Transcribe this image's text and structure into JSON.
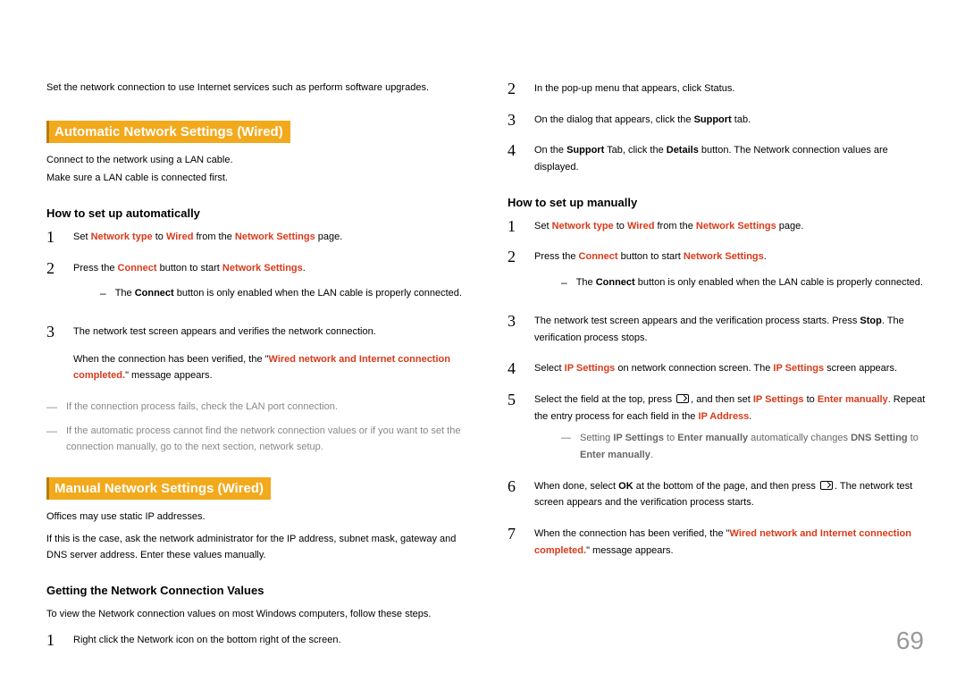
{
  "pageNumber": "69",
  "left": {
    "intro": "Set the network connection to use Internet services such as perform software upgrades.",
    "autoHeading": "Automatic Network Settings (Wired)",
    "autoSub1": "Connect to the network using a LAN cable.",
    "autoSub2": "Make sure a LAN cable is connected first.",
    "howAuto": "How to set up automatically",
    "step1_a": "Set ",
    "step1_b": "Network type",
    "step1_c": " to ",
    "step1_d": "Wired",
    "step1_e": " from the ",
    "step1_f": "Network Settings",
    "step1_g": " page.",
    "step2_a": "Press the ",
    "step2_b": "Connect",
    "step2_c": " button to start ",
    "step2_d": "Network Settings",
    "step2_e": ".",
    "step2_dash_a": "The ",
    "step2_dash_b": "Connect",
    "step2_dash_c": " button is only enabled when the LAN cable is properly connected.",
    "step3_a": "The network test screen appears and verifies the network connection.",
    "step3_b1": "When the connection has been verified, the \"",
    "step3_b2": "Wired network and Internet connection completed.",
    "step3_b3": "\" message appears.",
    "grayNote1": "If the connection process fails, check the LAN port connection.",
    "grayNote2": "If the automatic process cannot find the network connection values or if you want to set the connection manually, go to the next section, network setup.",
    "manualHeading": "Manual Network Settings (Wired)",
    "manualSub1": "Offices may use static IP addresses.",
    "manualSub2": "If this is the case, ask the network administrator for the IP address, subnet mask, gateway and DNS server address. Enter these values manually.",
    "gettingHead": "Getting the Network Connection Values",
    "gettingIntro": "To view the Network connection values on most Windows computers, follow these steps.",
    "gStep1": "Right click the Network icon on the bottom right of the screen."
  },
  "right": {
    "gStep2": "In the pop-up menu that appears, click Status.",
    "gStep3_a": "On the dialog that appears, click the ",
    "gStep3_b": "Support",
    "gStep3_c": " tab.",
    "gStep4_a": "On the ",
    "gStep4_b": "Support",
    "gStep4_c": " Tab, click the ",
    "gStep4_d": "Details",
    "gStep4_e": " button. The Network connection values are displayed.",
    "howManual": "How to set up manually",
    "m1_a": "Set ",
    "m1_b": "Network type",
    "m1_c": " to ",
    "m1_d": "Wired",
    "m1_e": " from the ",
    "m1_f": "Network Settings",
    "m1_g": " page.",
    "m2_a": "Press the ",
    "m2_b": "Connect",
    "m2_c": " button to start ",
    "m2_d": "Network Settings",
    "m2_e": ".",
    "m2_dash_a": "The ",
    "m2_dash_b": "Connect",
    "m2_dash_c": " button is only enabled when the LAN cable is properly connected.",
    "m3_a": "The network test screen appears and the verification process starts. Press ",
    "m3_b": "Stop",
    "m3_c": ". The verification process stops.",
    "m4_a": "Select ",
    "m4_b": "IP Settings",
    "m4_c": " on network connection screen. The ",
    "m4_d": "IP Settings",
    "m4_e": " screen appears.",
    "m5_a": "Select the field at the top, press ",
    "m5_b": ", and then set ",
    "m5_c": "IP Settings",
    "m5_d": " to ",
    "m5_e": "Enter manually",
    "m5_f": ". Repeat the entry process for each field in the ",
    "m5_g": "IP Address",
    "m5_h": ".",
    "m5_nest_a": "Setting ",
    "m5_nest_b": "IP Settings",
    "m5_nest_c": " to ",
    "m5_nest_d": "Enter manually",
    "m5_nest_e": " automatically changes ",
    "m5_nest_f": "DNS Setting",
    "m5_nest_g": " to ",
    "m5_nest_h": "Enter manually",
    "m5_nest_i": ".",
    "m6_a": "When done, select ",
    "m6_b": "OK",
    "m6_c": " at the bottom of the page, and then press ",
    "m6_d": ". The network test screen appears and the verification process starts.",
    "m7_a": "When the connection has been verified, the \"",
    "m7_b": "Wired network and Internet connection completed.",
    "m7_c": "\" message appears."
  }
}
